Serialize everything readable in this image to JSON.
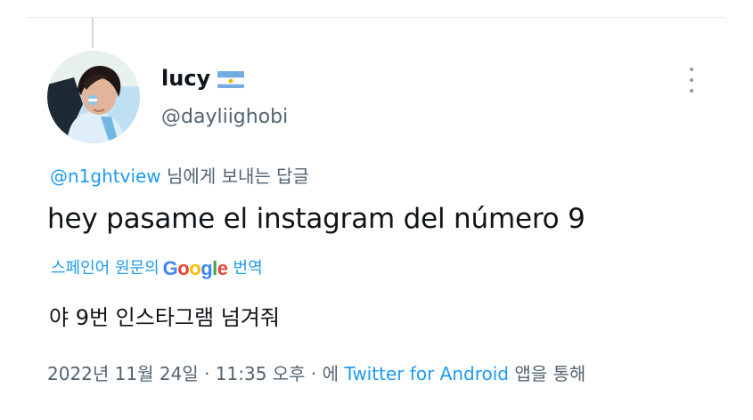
{
  "tweet": {
    "display_name": "lucy",
    "handle": "@dayliighobi",
    "reply_to_mention": "@n1ghtview",
    "reply_suffix": " 님에게 보내는 답글",
    "text": "hey pasame el instagram del número 9",
    "translate_prefix": "스페인어 원문의",
    "translate_suffix": "번역",
    "google_letters": [
      "G",
      "o",
      "o",
      "g",
      "l",
      "e"
    ],
    "translated_text": "야 9번 인스타그램 넘겨줘",
    "timestamp": "2022년 11월 24일 · 11:35 오후 · 에",
    "source_app": "Twitter for Android",
    "source_suffix": " 앱을 통해"
  },
  "icons": {
    "flag": "argentina-flag-icon",
    "more": "more-vertical-icon",
    "google": "google-logo"
  },
  "colors": {
    "link": "#1d9bf0",
    "secondary_text": "#536471",
    "primary_text": "#0f1419",
    "google_blue": "#4285f4",
    "google_red": "#ea4335",
    "google_yellow": "#fbbc05",
    "google_green": "#34a853"
  }
}
